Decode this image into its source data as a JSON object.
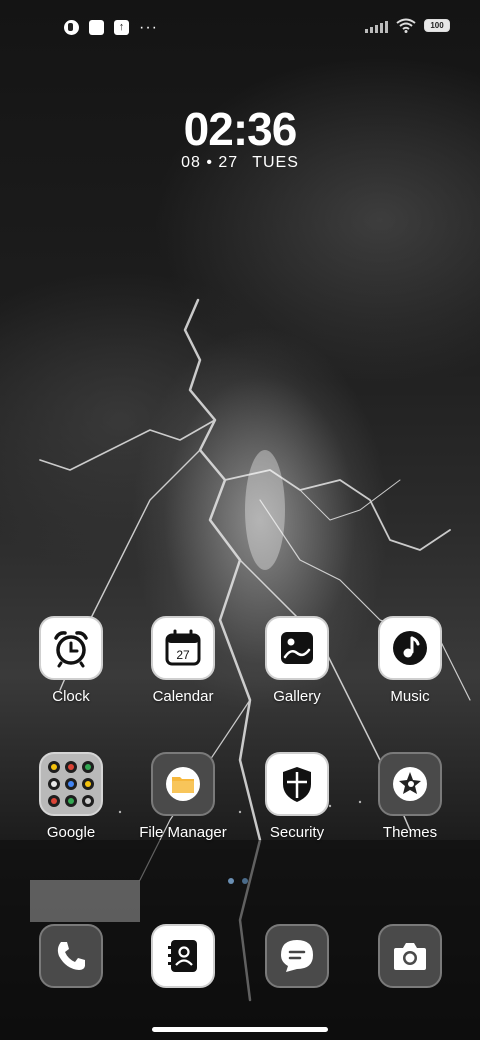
{
  "status_bar": {
    "left_icons": [
      "notification-app-icon",
      "notification-square-icon",
      "upload-icon"
    ],
    "more": "···",
    "battery": "100"
  },
  "clock_widget": {
    "time": "02:36",
    "date": "08 • 27",
    "weekday": "TUES"
  },
  "apps_row1": [
    {
      "label": "Clock",
      "icon": "alarm-clock-icon"
    },
    {
      "label": "Calendar",
      "icon": "calendar-icon",
      "badge": "27"
    },
    {
      "label": "Gallery",
      "icon": "image-icon"
    },
    {
      "label": "Music",
      "icon": "music-note-icon"
    }
  ],
  "apps_row2": [
    {
      "label": "Google",
      "icon": "folder-icon"
    },
    {
      "label": "File Manager",
      "icon": "file-folder-icon"
    },
    {
      "label": "Security",
      "icon": "shield-icon"
    },
    {
      "label": "Themes",
      "icon": "theme-star-icon"
    }
  ],
  "dock": [
    {
      "icon": "phone-icon"
    },
    {
      "icon": "contacts-icon"
    },
    {
      "icon": "messages-icon"
    },
    {
      "icon": "camera-icon"
    }
  ],
  "colors": {
    "file_manager_accent": "#f6b73c",
    "page_dot_active": "#6a8fb3",
    "page_dot_inactive": "#4a6b8a",
    "google_dots": [
      "#f4c20d",
      "#db4437",
      "#34a853",
      "#e8e8e8",
      "#4285f4",
      "#f4c20d",
      "#db4437",
      "#34a853",
      "#cccccc"
    ]
  }
}
